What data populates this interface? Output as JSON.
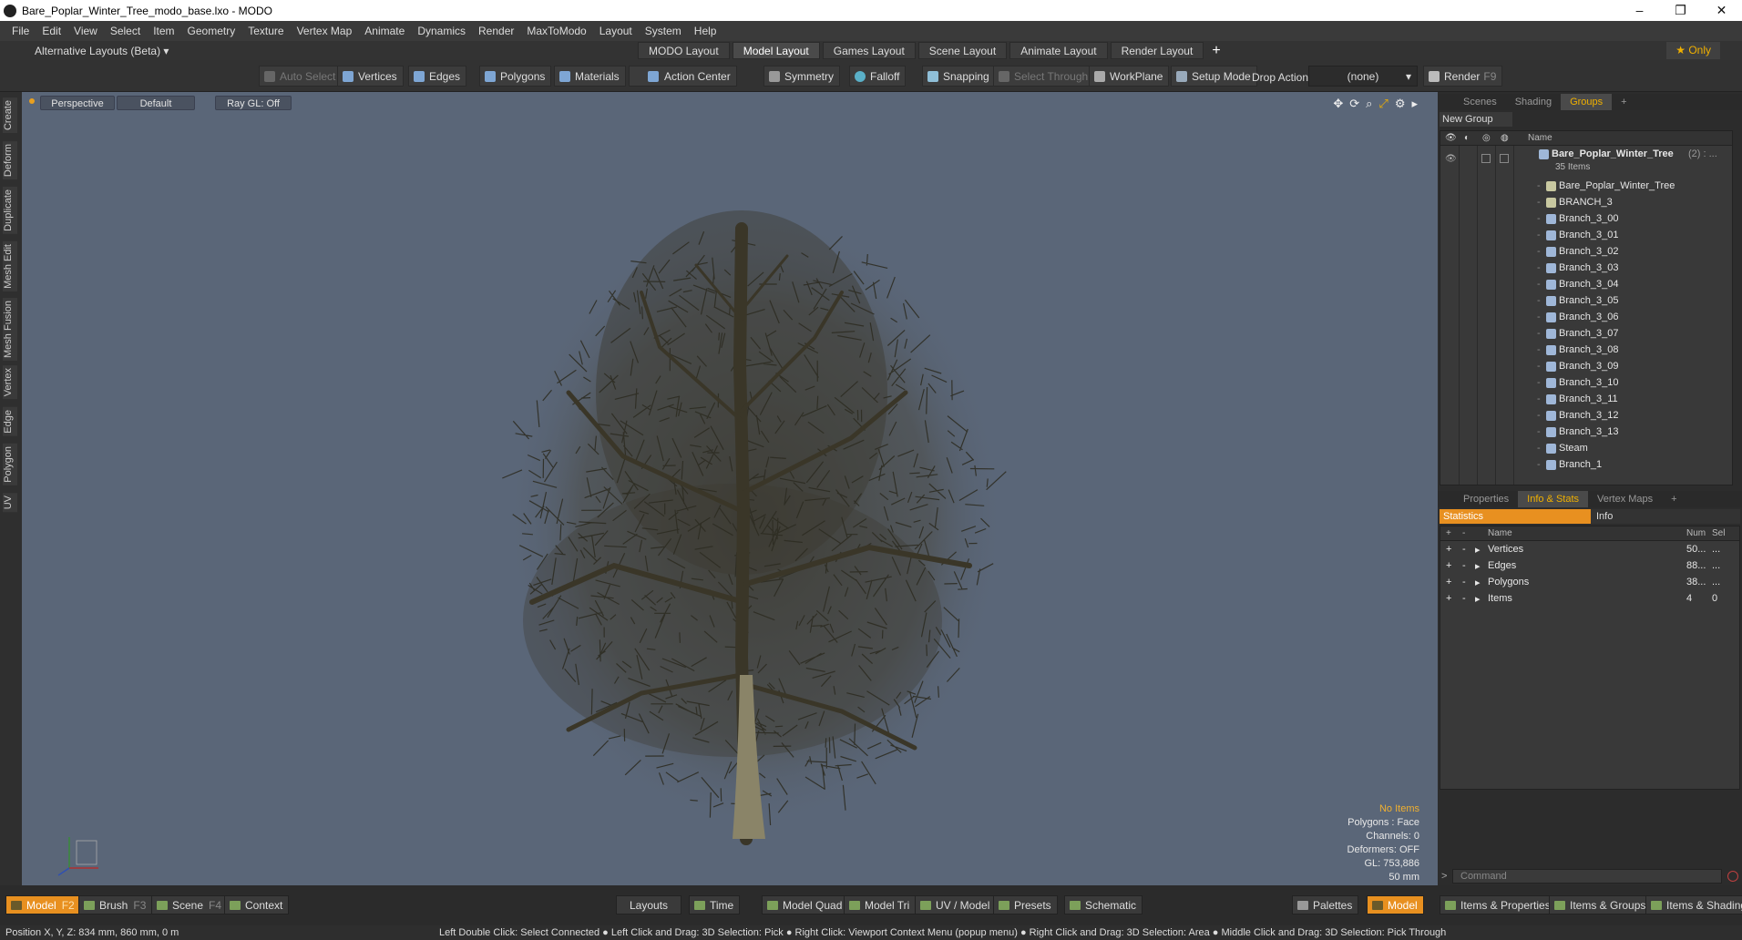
{
  "window": {
    "title": "Bare_Poplar_Winter_Tree_modo_base.lxo - MODO",
    "min": "–",
    "max": "❐",
    "close": "✕"
  },
  "menu": [
    "File",
    "Edit",
    "View",
    "Select",
    "Item",
    "Geometry",
    "Texture",
    "Vertex Map",
    "Animate",
    "Dynamics",
    "Render",
    "MaxToModo",
    "Layout",
    "System",
    "Help"
  ],
  "layoutbar": {
    "alt_layouts": "Alternative Layouts (Beta) ▾",
    "tabs": [
      "MODO Layout",
      "Model Layout",
      "Games Layout",
      "Scene Layout",
      "Animate Layout",
      "Render Layout"
    ],
    "active_tab": "Model Layout",
    "plus": "+",
    "only": "★ Only"
  },
  "toolbar": {
    "auto_select": "Auto Select",
    "vertices": "Vertices",
    "edges": "Edges",
    "polygons": "Polygons",
    "materials": "Materials",
    "action_center": "Action Center",
    "symmetry": "Symmetry",
    "falloff": "Falloff",
    "snapping": "Snapping",
    "select_through": "Select Through",
    "workplane": "WorkPlane",
    "setup_mode": "Setup Mode",
    "drop_action": "Drop Action",
    "drop_value": "(none)",
    "render": "Render",
    "render_key": "F9"
  },
  "left_tabs": [
    "Create",
    "Deform",
    "Duplicate",
    "Mesh Edit",
    "Mesh Fusion",
    "Vertex",
    "Edge",
    "Polygon",
    "UV"
  ],
  "viewport": {
    "view": "Perspective",
    "style": "Default",
    "raygl": "Ray GL: Off",
    "hud": {
      "items": "No Items",
      "polygons": "Polygons : Face",
      "channels": "Channels: 0",
      "deformers": "Deformers: OFF",
      "gl": "GL: 753,886",
      "scale": "50 mm"
    }
  },
  "groups_panel": {
    "tabs": [
      "Scenes",
      "Shading",
      "Groups"
    ],
    "active_tab": "Groups",
    "new_group": "New Group",
    "col_name": "Name",
    "root": {
      "label": "Bare_Poplar_Winter_Tree",
      "count": "(2) : ...",
      "sub": "35 Items"
    },
    "items": [
      "Bare_Poplar_Winter_Tree",
      "BRANCH_3",
      "Branch_3_00",
      "Branch_3_01",
      "Branch_3_02",
      "Branch_3_03",
      "Branch_3_04",
      "Branch_3_05",
      "Branch_3_06",
      "Branch_3_07",
      "Branch_3_08",
      "Branch_3_09",
      "Branch_3_10",
      "Branch_3_11",
      "Branch_3_12",
      "Branch_3_13",
      "Steam",
      "Branch_1"
    ]
  },
  "stats_panel": {
    "tabs": [
      "Properties",
      "Info & Stats",
      "Vertex Maps"
    ],
    "active_tab": "Info & Stats",
    "statistics": "Statistics",
    "info": "Info",
    "cols": {
      "name": "Name",
      "num": "Num",
      "sel": "Sel"
    },
    "rows": [
      {
        "name": "Vertices",
        "num": "50...",
        "sel": "..."
      },
      {
        "name": "Edges",
        "num": "88...",
        "sel": "..."
      },
      {
        "name": "Polygons",
        "num": "38...",
        "sel": "..."
      },
      {
        "name": "Items",
        "num": "4",
        "sel": "0"
      }
    ],
    "command_placeholder": "Command"
  },
  "bottombar": {
    "model": "Model",
    "model_key": "F2",
    "brush": "Brush",
    "brush_key": "F3",
    "scene": "Scene",
    "scene_key": "F4",
    "context": "Context",
    "layouts": "Layouts",
    "time": "Time",
    "model_quad": "Model Quad",
    "model_tri": "Model Tri",
    "uv_model": "UV / Model",
    "presets": "Presets",
    "schematic": "Schematic",
    "palettes": "Palettes",
    "model2": "Model",
    "items_props": "Items & Properties",
    "items_groups": "Items & Groups",
    "items_shading": "Items & Shading"
  },
  "status": {
    "position": "Position X, Y, Z:   834 mm, 860 mm, 0 m",
    "hints": "Left Double Click: Select Connected ● Left Click and Drag: 3D Selection: Pick ● Right Click: Viewport Context Menu (popup menu) ● Right Click and Drag: 3D Selection: Area ● Middle Click and Drag: 3D Selection: Pick Through"
  },
  "colors": {
    "accent": "#e89020",
    "viewport_bg": "#5a6678"
  }
}
